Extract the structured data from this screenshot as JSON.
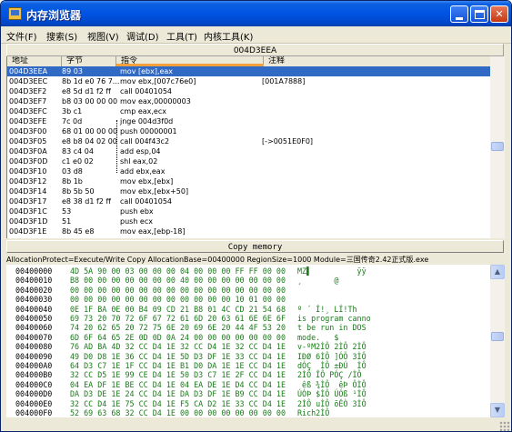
{
  "window": {
    "title": "内存浏览器",
    "min_label": "",
    "max_label": "",
    "close_label": "✕"
  },
  "menu": [
    "文件(F)",
    "搜索(S)",
    "视图(V)",
    "调试(D)",
    "工具(T)",
    "内核工具(K)"
  ],
  "disasm": {
    "address_header": "004D3EEA",
    "columns": [
      "地址",
      "字节",
      "指令",
      "注释"
    ],
    "rows": [
      {
        "addr": "004D3EEA",
        "bytes": "89 03",
        "op": "mov [ebx],eax",
        "cmt": "",
        "selected": true
      },
      {
        "addr": "004D3EEC",
        "bytes": "8b 1d e0 76 7...",
        "op": "mov ebx,[007c76e0]",
        "cmt": "[001A7888]"
      },
      {
        "addr": "004D3EF2",
        "bytes": "e8 5d d1 f2 ff",
        "op": "call 00401054",
        "cmt": ""
      },
      {
        "addr": "004D3EF7",
        "bytes": "b8 03 00 00 00",
        "op": "mov eax,00000003",
        "cmt": ""
      },
      {
        "addr": "004D3EFC",
        "bytes": "3b c1",
        "op": "cmp eax,ecx",
        "cmt": ""
      },
      {
        "addr": "004D3EFE",
        "bytes": "7c 0d",
        "op": "jnge 004d3f0d",
        "cmt": ""
      },
      {
        "addr": "004D3F00",
        "bytes": "68 01 00 00 00",
        "op": "push 00000001",
        "cmt": ""
      },
      {
        "addr": "004D3F05",
        "bytes": "e8 b8 04 02 00",
        "op": "call 004f43c2",
        "cmt": "[->0051E0F0]"
      },
      {
        "addr": "004D3F0A",
        "bytes": "83 c4 04",
        "op": "add esp,04",
        "cmt": ""
      },
      {
        "addr": "004D3F0D",
        "bytes": "c1 e0 02",
        "op": "shl eax,02",
        "cmt": ""
      },
      {
        "addr": "004D3F10",
        "bytes": "03 d8",
        "op": "add ebx,eax",
        "cmt": ""
      },
      {
        "addr": "004D3F12",
        "bytes": "8b 1b",
        "op": "mov ebx,[ebx]",
        "cmt": ""
      },
      {
        "addr": "004D3F14",
        "bytes": "8b 5b 50",
        "op": "mov ebx,[ebx+50]",
        "cmt": ""
      },
      {
        "addr": "004D3F17",
        "bytes": "e8 38 d1 f2 ff",
        "op": "call 00401054",
        "cmt": ""
      },
      {
        "addr": "004D3F1C",
        "bytes": "53",
        "op": "push ebx",
        "cmt": ""
      },
      {
        "addr": "004D3F1D",
        "bytes": "51",
        "op": "push ecx",
        "cmt": ""
      },
      {
        "addr": "004D3F1E",
        "bytes": "8b 45 e8",
        "op": "mov eax,[ebp-18]",
        "cmt": ""
      }
    ]
  },
  "copy_memory_label": "Copy memory",
  "info_line": "AllocationProtect=Execute/Write Copy  AllocationBase=00400000 RegionSize=1000 Module=三国传奇2.42正式版.exe",
  "hex": {
    "rows": [
      {
        "addr": "00400000",
        "bytes": "4D 5A 90 00 03 00 00 00 04 00 00 00 FF FF 00 00",
        "ascii": "MZ▌          ÿÿ"
      },
      {
        "addr": "00400010",
        "bytes": "B8 00 00 00 00 00 00 00 40 00 00 00 00 00 00 00",
        "ascii": "¸       @"
      },
      {
        "addr": "00400020",
        "bytes": "00 00 00 00 00 00 00 00 00 00 00 00 00 00 00 00",
        "ascii": ""
      },
      {
        "addr": "00400030",
        "bytes": "00 00 00 00 00 00 00 00 00 00 00 00 10 01 00 00",
        "ascii": ""
      },
      {
        "addr": "00400040",
        "bytes": "0E 1F BA 0E 00 B4 09 CD 21 B8 01 4C CD 21 54 68",
        "ascii": "º ´ Í!¸ LÍ!Th"
      },
      {
        "addr": "00400050",
        "bytes": "69 73 20 70 72 6F 67 72 61 6D 20 63 61 6E 6E 6F",
        "ascii": "is program canno"
      },
      {
        "addr": "00400060",
        "bytes": "74 20 62 65 20 72 75 6E 20 69 6E 20 44 4F 53 20",
        "ascii": "t be run in DOS"
      },
      {
        "addr": "00400070",
        "bytes": "6D 6F 64 65 2E 0D 0D 0A 24 00 00 00 00 00 00 00",
        "ascii": "mode.   $"
      },
      {
        "addr": "00400080",
        "bytes": "76 AD BA 4D 32 CC D4 1E 32 CC D4 1E 32 CC D4 1E",
        "ascii": "v-ºM2ÌÔ 2ÌÔ 2ÌÔ"
      },
      {
        "addr": "00400090",
        "bytes": "49 D0 D8 1E 36 CC D4 1E 5D D3 DF 1E 33 CC D4 1E",
        "ascii": "IÐØ 6ÌÔ ]ÓÖ 3ÌÔ"
      },
      {
        "addr": "004000A0",
        "bytes": "64 D3 C7 1E 1F CC D4 1E B1 D0 DA 1E 1E CC D4 1E",
        "ascii": "dÓÇ  ÌÔ ±ÐÚ  ÌÔ"
      },
      {
        "addr": "004000B0",
        "bytes": "32 CC D5 1E 99 CE D4 1E 50 D3 C7 1E 2F CC D4 1E",
        "ascii": "2ÌÕ ÎÔ PÓÇ /ÌÔ"
      },
      {
        "addr": "004000C0",
        "bytes": "04 EA DF 1E BE CC D4 1E 04 EA DE 1E D4 CC D4 1E",
        "ascii": " êß ¾ÌÔ  êÞ ÔÌÔ"
      },
      {
        "addr": "004000D0",
        "bytes": "DA D3 DE 1E 24 CC D4 1E DA D3 DF 1E B9 CC D4 1E",
        "ascii": "ÚÓÞ $ÌÔ ÚÓß ¹ÌÔ"
      },
      {
        "addr": "004000E0",
        "bytes": "32 CC D4 1E 75 CC D4 1E F5 CA D2 1E 33 CC D4 1E",
        "ascii": "2ÌÔ uÌÔ õÊÒ 3ÌÔ"
      },
      {
        "addr": "004000F0",
        "bytes": "52 69 63 68 32 CC D4 1E 00 00 00 00 00 00 00 00",
        "ascii": "Rich2ÌÔ"
      }
    ]
  }
}
